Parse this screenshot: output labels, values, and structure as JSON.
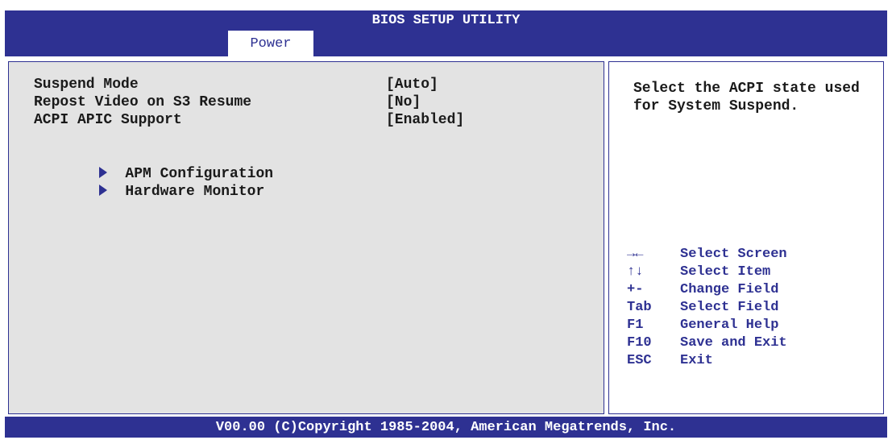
{
  "header": {
    "title": "BIOS SETUP UTILITY",
    "active_tab": "Power"
  },
  "settings": [
    {
      "label": "Suspend Mode",
      "value": "[Auto]"
    },
    {
      "label": "Repost Video on S3 Resume",
      "value": "[No]"
    },
    {
      "label": "ACPI APIC Support",
      "value": "[Enabled]"
    }
  ],
  "submenus": [
    {
      "label": "APM Configuration"
    },
    {
      "label": "Hardware Monitor"
    }
  ],
  "help": {
    "text": "Select the ACPI state used for System Suspend."
  },
  "keys": [
    {
      "key": "→←",
      "action": "Select Screen"
    },
    {
      "key": "↑↓",
      "action": "Select Item"
    },
    {
      "key": "+-",
      "action": "Change Field"
    },
    {
      "key": "Tab",
      "action": "Select Field"
    },
    {
      "key": "F1",
      "action": "General Help"
    },
    {
      "key": "F10",
      "action": "Save and Exit"
    },
    {
      "key": "ESC",
      "action": "Exit"
    }
  ],
  "footer": {
    "copyright": "V00.00 (C)Copyright 1985-2004, American Megatrends, Inc."
  },
  "colors": {
    "frame": "#2e3192",
    "left_pane_bg": "#e3e3e3",
    "right_pane_bg": "#ffffff",
    "text": "#1a1a1a",
    "key_text": "#2e3192"
  }
}
